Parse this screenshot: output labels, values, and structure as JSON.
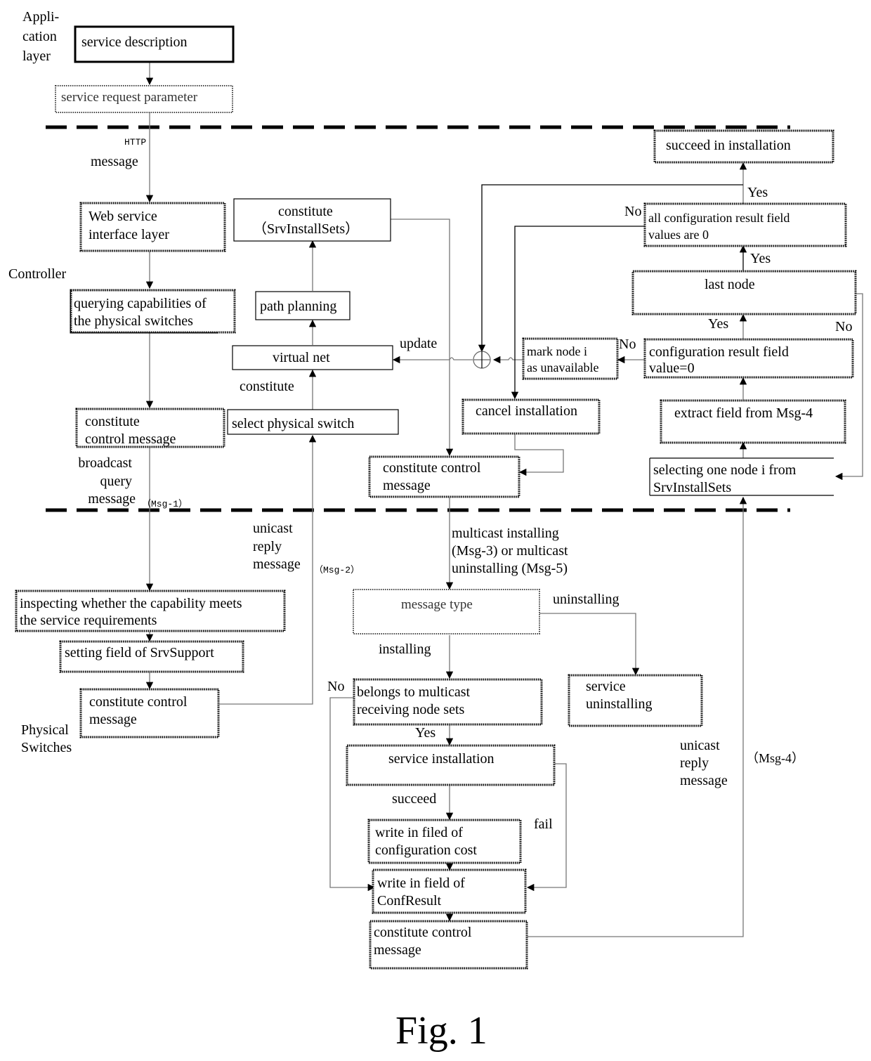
{
  "figure": {
    "caption": "Fig. 1"
  },
  "layers": {
    "application": [
      "Appli-",
      "cation",
      "layer"
    ],
    "controller": "Controller",
    "physical": [
      "Physical",
      "Switches"
    ]
  },
  "boxes": {
    "service_description": [
      "service description"
    ],
    "service_request_parameter": [
      "service request parameter"
    ],
    "web_service_interface": [
      "Web service",
      "interface layer"
    ],
    "querying_capabilities": [
      "querying capabilities of",
      " the physical switches"
    ],
    "constitute_control_message_ctrl": [
      "constitute",
      "control message"
    ],
    "select_physical_switch": [
      "select physical switch"
    ],
    "virtual_net": [
      "virtual net"
    ],
    "path_planning": [
      "path planning"
    ],
    "constitute_srvinstallsets": [
      "constitute",
      "（SrvInstallSets）"
    ],
    "constitute_control_message_multicast": [
      "constitute control",
      "message"
    ],
    "cancel_installation": [
      "cancel installation"
    ],
    "mark_node_unavailable": [
      "mark node i",
      "as unavailable"
    ],
    "succeed_in_installation": [
      "succeed in installation"
    ],
    "all_config_result_zero": [
      "all configuration result field",
      "values are 0"
    ],
    "last_node": [
      "last node"
    ],
    "config_result_field_zero": [
      "configuration result field",
      "value=0"
    ],
    "extract_field_msg4": [
      "extract field from Msg-4"
    ],
    "selecting_one_node": [
      "selecting one node i from",
      "SrvInstallSets"
    ],
    "inspecting_capability": [
      "inspecting whether the capability meets",
      "the service requirements"
    ],
    "setting_srvsupport": [
      "setting field of SrvSupport"
    ],
    "constitute_control_message_phys": [
      "constitute control",
      "message"
    ],
    "message_type": [
      "message type"
    ],
    "belongs_to_multicast": [
      "belongs to multicast",
      "receiving node sets"
    ],
    "service_uninstalling": [
      "service",
      "uninstalling"
    ],
    "service_installation": [
      "service installation"
    ],
    "write_config_cost": [
      "write in filed of",
      "configuration cost"
    ],
    "write_confresult": [
      "write in field of",
      "ConfResult"
    ],
    "constitute_control_message_reply": [
      "constitute control",
      "message"
    ]
  },
  "labels": {
    "http": "HTTP",
    "message": "message",
    "update": "update",
    "constitute": "constitute",
    "broadcast_query_message": [
      "broadcast",
      "query",
      "message"
    ],
    "msg1": "（Msg-1）",
    "unicast_reply_message_2": [
      "unicast",
      "reply",
      "message"
    ],
    "msg2": "（Msg-2）",
    "multicast_msg": [
      "multicast installing",
      "(Msg-3) or multicast",
      "uninstalling (Msg-5)"
    ],
    "uninstalling": "uninstalling",
    "installing": "installing",
    "no": "No",
    "yes": "Yes",
    "succeed": "succeed",
    "fail": "fail",
    "unicast_reply_message_4": [
      "unicast",
      "reply",
      "message"
    ],
    "msg4": "（Msg-4）"
  }
}
